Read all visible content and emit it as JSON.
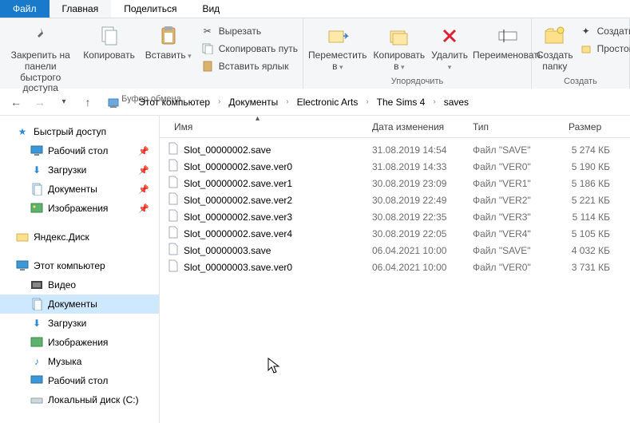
{
  "tabs": {
    "file": "Файл",
    "home": "Главная",
    "share": "Поделиться",
    "view": "Вид"
  },
  "ribbon": {
    "pin": "Закрепить на панели\nбыстрого доступа",
    "copy": "Копировать",
    "paste": "Вставить",
    "cut": "Вырезать",
    "copypath": "Скопировать путь",
    "pasteshortcut": "Вставить ярлык",
    "group_clipboard": "Буфер обмена",
    "moveto": "Переместить в",
    "copyto": "Копировать в",
    "delete": "Удалить",
    "rename": "Переименовать",
    "group_organize": "Упорядочить",
    "newfolder": "Создать папку",
    "newitem": "Создать э",
    "easyaccess": "Простой",
    "group_new": "Создать"
  },
  "breadcrumb": [
    "Этот компьютер",
    "Документы",
    "Electronic Arts",
    "The Sims 4",
    "saves"
  ],
  "columns": {
    "name": "Имя",
    "date": "Дата изменения",
    "type": "Тип",
    "size": "Размер"
  },
  "files": [
    {
      "name": "Slot_00000002.save",
      "date": "31.08.2019 14:54",
      "type": "Файл \"SAVE\"",
      "size": "5 274 КБ"
    },
    {
      "name": "Slot_00000002.save.ver0",
      "date": "31.08.2019 14:33",
      "type": "Файл \"VER0\"",
      "size": "5 190 КБ"
    },
    {
      "name": "Slot_00000002.save.ver1",
      "date": "30.08.2019 23:09",
      "type": "Файл \"VER1\"",
      "size": "5 186 КБ"
    },
    {
      "name": "Slot_00000002.save.ver2",
      "date": "30.08.2019 22:49",
      "type": "Файл \"VER2\"",
      "size": "5 221 КБ"
    },
    {
      "name": "Slot_00000002.save.ver3",
      "date": "30.08.2019 22:35",
      "type": "Файл \"VER3\"",
      "size": "5 114 КБ"
    },
    {
      "name": "Slot_00000002.save.ver4",
      "date": "30.08.2019 22:05",
      "type": "Файл \"VER4\"",
      "size": "5 105 КБ"
    },
    {
      "name": "Slot_00000003.save",
      "date": "06.04.2021 10:00",
      "type": "Файл \"SAVE\"",
      "size": "4 032 КБ"
    },
    {
      "name": "Slot_00000003.save.ver0",
      "date": "06.04.2021 10:00",
      "type": "Файл \"VER0\"",
      "size": "3 731 КБ"
    }
  ],
  "sidebar": {
    "quick": "Быстрый доступ",
    "desktop": "Рабочий стол",
    "downloads": "Загрузки",
    "documents": "Документы",
    "pictures": "Изображения",
    "yandex": "Яндекс.Диск",
    "thispc": "Этот компьютер",
    "videos": "Видео",
    "documents2": "Документы",
    "downloads2": "Загрузки",
    "pictures2": "Изображения",
    "music": "Музыка",
    "desktop2": "Рабочий стол",
    "localc": "Локальный диск (C:)"
  }
}
